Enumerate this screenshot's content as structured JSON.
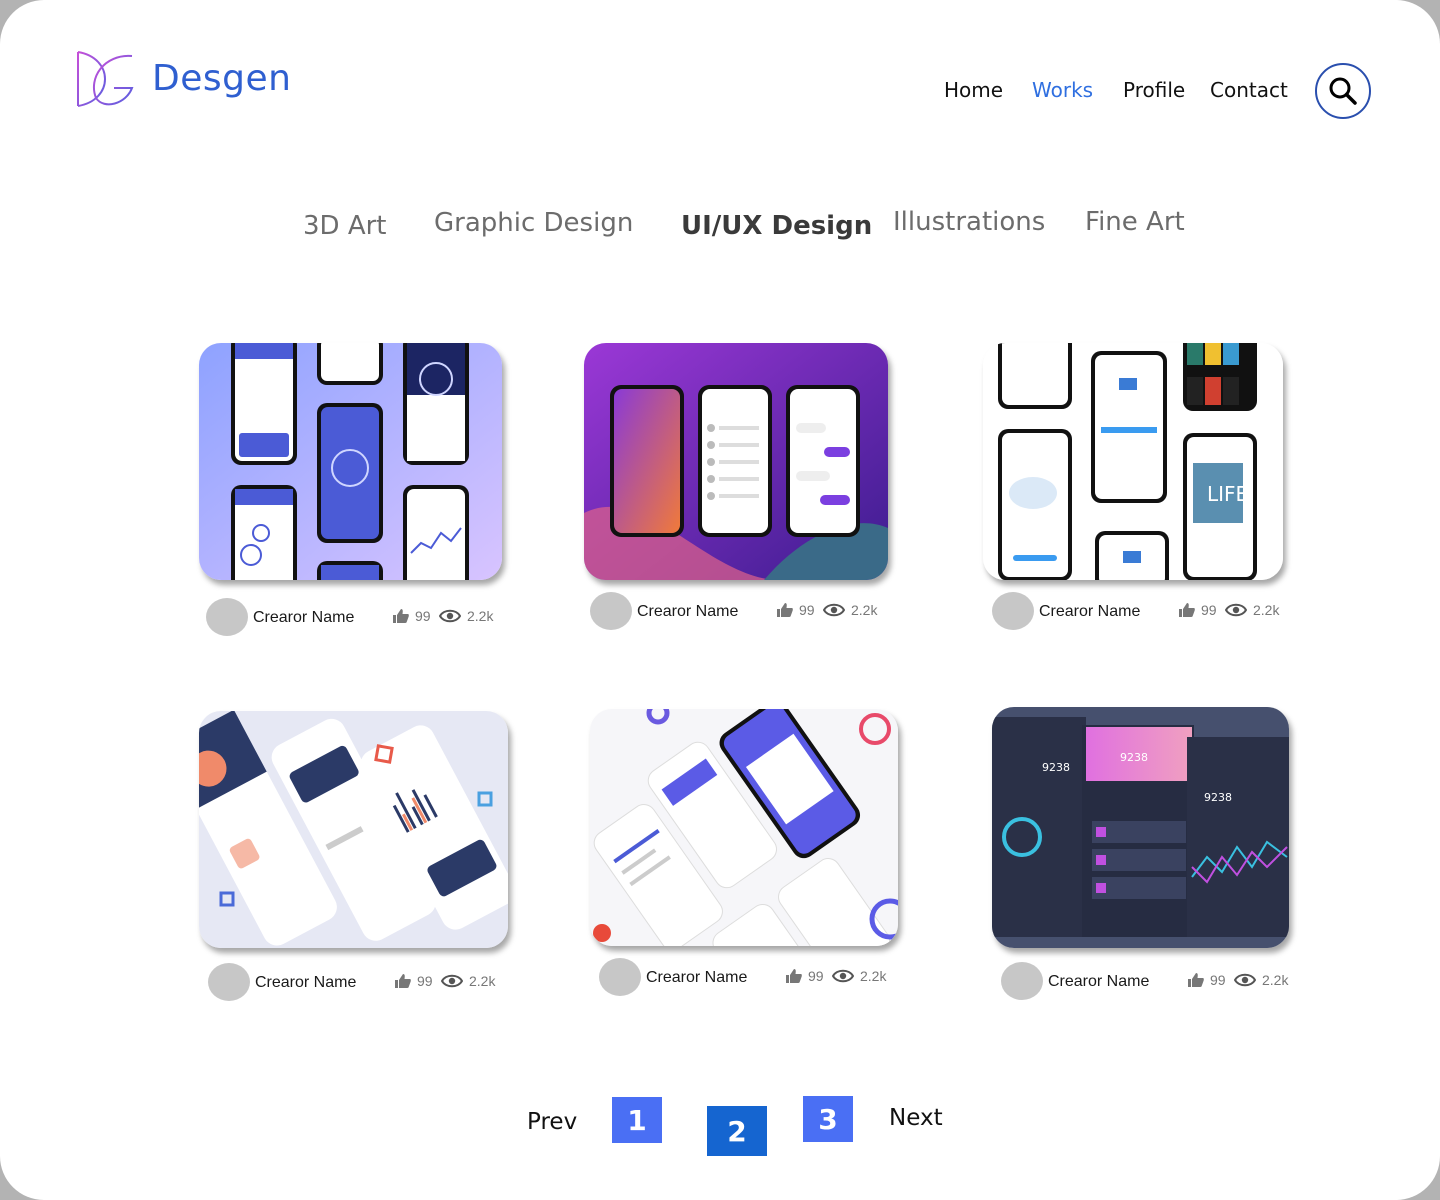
{
  "brand": {
    "name": "Desgen"
  },
  "nav": {
    "items": [
      "Home",
      "Works",
      "Profile",
      "Contact"
    ],
    "active": "Works",
    "search_icon": "search-icon"
  },
  "categories": {
    "items": [
      "3D Art",
      "Graphic Design",
      "UI/UX Design",
      "Illustrations",
      "Fine Art"
    ],
    "active": "UI/UX Design"
  },
  "cards": [
    {
      "creator": "Crearor Name",
      "likes": "99",
      "views": "2.2k",
      "preview": "banking app screens"
    },
    {
      "creator": "Crearor Name",
      "likes": "99",
      "views": "2.2k",
      "preview": "chatroom app screens"
    },
    {
      "creator": "Crearor Name",
      "likes": "99",
      "views": "2.2k",
      "preview": "book app screens"
    },
    {
      "creator": "Crearor Name",
      "likes": "99",
      "views": "2.2k",
      "preview": "payment cards app screens"
    },
    {
      "creator": "Crearor Name",
      "likes": "99",
      "views": "2.2k",
      "preview": "task app screens"
    },
    {
      "creator": "Crearor Name",
      "likes": "99",
      "views": "2.2k",
      "preview": "dark wallet dashboard"
    }
  ],
  "pagination": {
    "prev": "Prev",
    "pages": [
      "1",
      "2",
      "3"
    ],
    "current": "2",
    "next": "Next"
  },
  "colors": {
    "brand_blue": "#2f5fd0",
    "active_nav": "#2f6fe0",
    "page_box": "#4a6ff4",
    "page_current": "#1565d0"
  }
}
